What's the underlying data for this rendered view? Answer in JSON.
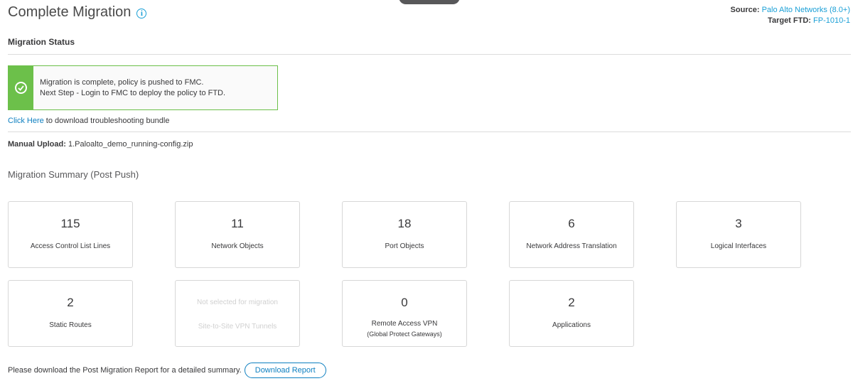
{
  "header": {
    "title": "Complete Migration",
    "source_label": "Source:",
    "source_value": "Palo Alto Networks (8.0+)",
    "target_label": "Target FTD:",
    "target_value": "FP-1010-1"
  },
  "status": {
    "heading": "Migration Status",
    "line1": "Migration is complete, policy is pushed to FMC.",
    "line2": "Next Step - Login to FMC to deploy the policy to FTD.",
    "click_link": "Click Here",
    "click_rest": " to download troubleshooting bundle",
    "manual_label": "Manual Upload:",
    "manual_value": " 1.Paloalto_demo_running-config.zip"
  },
  "summary": {
    "heading": "Migration Summary (Post Push)",
    "cards": [
      {
        "value": "115",
        "label": "Access Control List Lines"
      },
      {
        "value": "11",
        "label": "Network Objects"
      },
      {
        "value": "18",
        "label": "Port Objects"
      },
      {
        "value": "6",
        "label": "Network Address Translation"
      },
      {
        "value": "3",
        "label": "Logical Interfaces"
      },
      {
        "value": "2",
        "label": "Static Routes"
      },
      {
        "value": "Not selected for migration",
        "label": "Site-to-Site VPN Tunnels"
      },
      {
        "value": "0",
        "label": "Remote Access VPN",
        "sub": "(Global Protect Gateways)"
      },
      {
        "value": "2",
        "label": "Applications"
      }
    ]
  },
  "footer": {
    "text": "Please download the Post Migration Report for a detailed summary.",
    "button": "Download Report"
  },
  "colors": {
    "accent": "#1a9fd6",
    "success": "#6cc04a",
    "link": "#0d7fc0"
  }
}
